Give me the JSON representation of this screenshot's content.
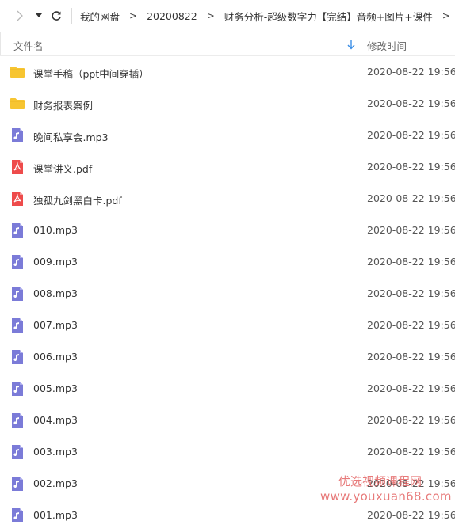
{
  "toolbar": {
    "breadcrumb": [
      "我的网盘",
      "20200822",
      "财务分析-超级数字力【完结】音频+图片+课件"
    ],
    "separator": ">"
  },
  "header": {
    "name_label": "文件名",
    "date_label": "修改时间"
  },
  "files": [
    {
      "name": "课堂手稿（ppt中间穿插）",
      "type": "folder",
      "date": "2020-08-22 19:56"
    },
    {
      "name": "财务报表案例",
      "type": "folder",
      "date": "2020-08-22 19:56"
    },
    {
      "name": "晚间私享会.mp3",
      "type": "audio",
      "date": "2020-08-22 19:56"
    },
    {
      "name": "课堂讲义.pdf",
      "type": "pdf",
      "date": "2020-08-22 19:56"
    },
    {
      "name": "独孤九剑黑白卡.pdf",
      "type": "pdf",
      "date": "2020-08-22 19:56"
    },
    {
      "name": "010.mp3",
      "type": "audio",
      "date": "2020-08-22 19:56"
    },
    {
      "name": "009.mp3",
      "type": "audio",
      "date": "2020-08-22 19:56"
    },
    {
      "name": "008.mp3",
      "type": "audio",
      "date": "2020-08-22 19:56"
    },
    {
      "name": "007.mp3",
      "type": "audio",
      "date": "2020-08-22 19:56"
    },
    {
      "name": "006.mp3",
      "type": "audio",
      "date": "2020-08-22 19:56"
    },
    {
      "name": "005.mp3",
      "type": "audio",
      "date": "2020-08-22 19:56"
    },
    {
      "name": "004.mp3",
      "type": "audio",
      "date": "2020-08-22 19:56"
    },
    {
      "name": "003.mp3",
      "type": "audio",
      "date": "2020-08-22 19:56"
    },
    {
      "name": "002.mp3",
      "type": "audio",
      "date": "2020-08-22 19:56"
    },
    {
      "name": "001.mp3",
      "type": "audio",
      "date": "2020-08-22 19:56"
    }
  ],
  "watermark": {
    "line1": "优选视频课程网",
    "line2": "www.youxuan68.com"
  },
  "colors": {
    "folder": "#f7c531",
    "audio": "#7b7bd8",
    "pdf": "#ee4b4b",
    "sort_arrow": "#3a8ee6"
  }
}
